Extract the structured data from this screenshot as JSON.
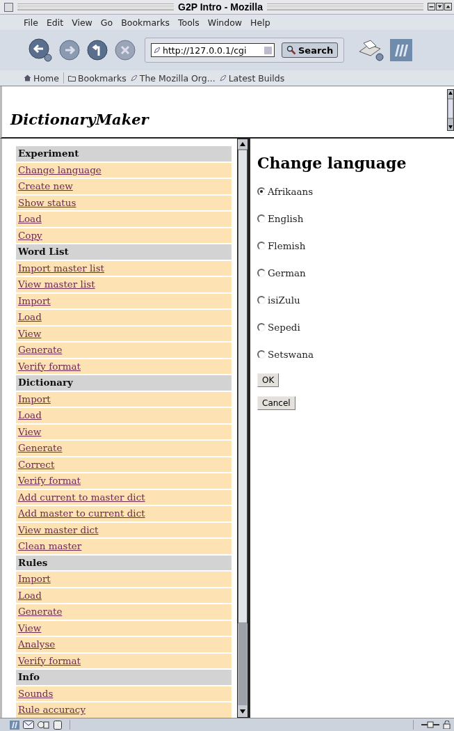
{
  "window": {
    "title": "G2P Intro - Mozilla"
  },
  "menu_bar": [
    "File",
    "Edit",
    "View",
    "Go",
    "Bookmarks",
    "Tools",
    "Window",
    "Help"
  ],
  "nav_toolbar": {
    "url": "http://127.0.0.1/cgi",
    "search_button": "Search"
  },
  "personal_toolbar": [
    "Home",
    "Bookmarks",
    "The Mozilla Org...",
    "Latest Builds"
  ],
  "header": {
    "title": "DictionaryMaker"
  },
  "sidebar": {
    "sections": [
      {
        "heading": "Experiment",
        "items": [
          "Change language",
          "Create new",
          "Show status",
          "Load",
          "Copy"
        ]
      },
      {
        "heading": "Word List",
        "items": [
          "Import master list",
          "View master list",
          "Import",
          "Load",
          "View",
          "Generate",
          "Verify format"
        ]
      },
      {
        "heading": "Dictionary",
        "items": [
          "Import",
          "Load",
          "View",
          "Generate",
          "Correct",
          "Verify format",
          "Add current to master dict",
          "Add master to current dict",
          "View master dict",
          "Clean master"
        ]
      },
      {
        "heading": "Rules",
        "items": [
          "Import",
          "Load",
          "Generate",
          "View",
          "Analyse",
          "Verify format"
        ]
      },
      {
        "heading": "Info",
        "items": [
          "Sounds",
          "Rule accuracy"
        ]
      }
    ]
  },
  "main": {
    "title": "Change language",
    "languages": [
      {
        "label": "Afrikaans",
        "selected": true
      },
      {
        "label": "English",
        "selected": false
      },
      {
        "label": "Flemish",
        "selected": false
      },
      {
        "label": "German",
        "selected": false
      },
      {
        "label": "isiZulu",
        "selected": false
      },
      {
        "label": "Sepedi",
        "selected": false
      },
      {
        "label": "Setswana",
        "selected": false
      }
    ],
    "buttons": [
      "OK",
      "Cancel"
    ]
  }
}
